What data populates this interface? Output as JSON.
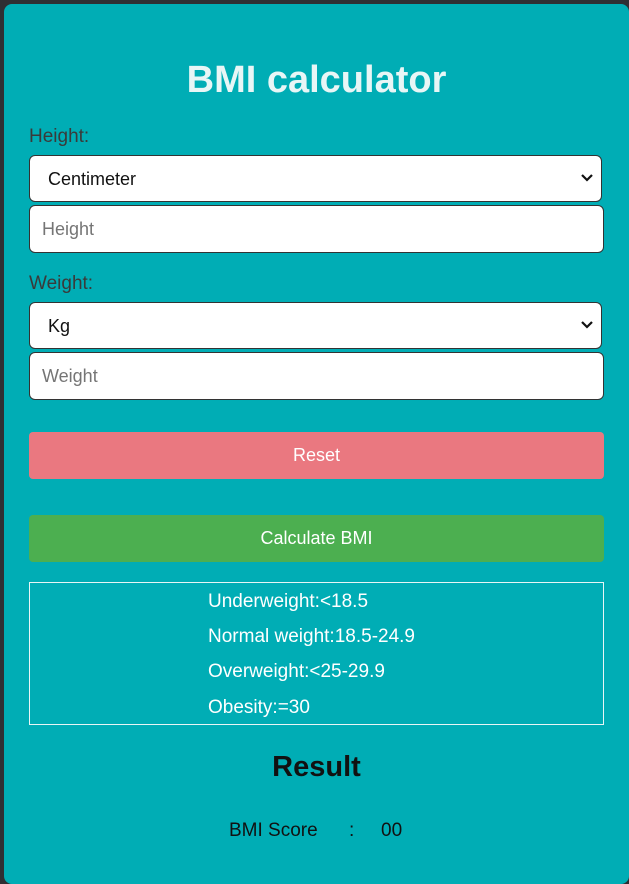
{
  "title": "BMI calculator",
  "height": {
    "label": "Height:",
    "unit_selected": "Centimeter",
    "placeholder": "Height"
  },
  "weight": {
    "label": "Weight:",
    "unit_selected": "Kg",
    "placeholder": "Weight"
  },
  "buttons": {
    "reset": "Reset",
    "calculate": "Calculate BMI"
  },
  "ranges": [
    "Underweight:<18.5",
    "Normal weight:18.5-24.9",
    "Overweight:<25-29.9",
    "Obesity:=30"
  ],
  "result": {
    "title": "Result",
    "score_label": "BMI Score",
    "separator": ":",
    "score_value": "00"
  },
  "colors": {
    "background": "#00adb5",
    "reset_button": "#ea7880",
    "calculate_button": "#4caf50"
  }
}
